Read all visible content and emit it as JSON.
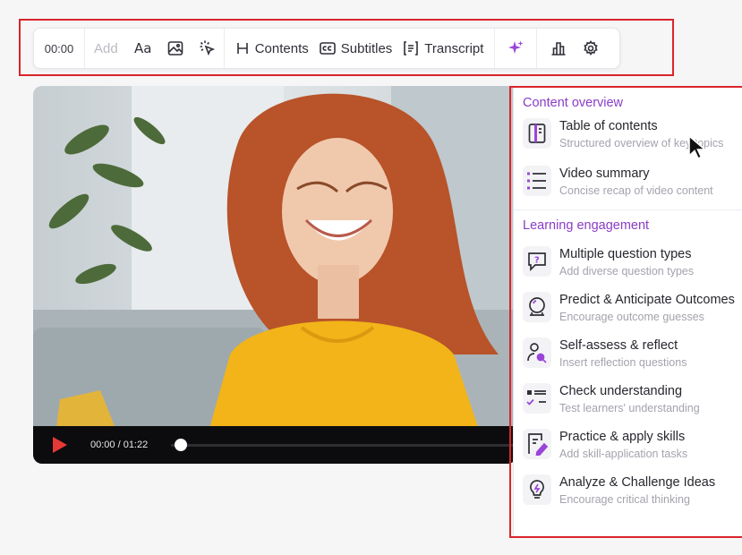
{
  "toolbar": {
    "time": "00:00",
    "add_label": "Add",
    "contents_label": "Contents",
    "subtitles_label": "Subtitles",
    "transcript_label": "Transcript",
    "icons": [
      "text-style-icon",
      "image-icon",
      "interactive-click-icon",
      "heading-icon",
      "subtitles-icon",
      "transcript-icon",
      "sparkle-icon",
      "chart-icon",
      "gear-icon"
    ]
  },
  "player": {
    "time": "00:00 / 01:22",
    "progress_percent": 0
  },
  "menu": {
    "section1_title": "Content overview",
    "section2_title": "Learning engagement",
    "items": [
      {
        "title": "Table of contents",
        "subtitle": "Structured overview of key topics",
        "icon": "book-icon"
      },
      {
        "title": "Video summary",
        "subtitle": "Concise recap of video content",
        "icon": "list-icon"
      },
      {
        "title": "Multiple question types",
        "subtitle": "Add diverse question types",
        "icon": "question-icon"
      },
      {
        "title": "Predict & Anticipate Outcomes",
        "subtitle": "Encourage outcome guesses",
        "icon": "crystal-ball-icon"
      },
      {
        "title": "Self-assess & reflect",
        "subtitle": "Insert reflection questions",
        "icon": "person-search-icon"
      },
      {
        "title": "Check understanding",
        "subtitle": "Test learners' understanding",
        "icon": "checklist-icon"
      },
      {
        "title": "Practice & apply skills",
        "subtitle": "Add skill-application tasks",
        "icon": "edit-document-icon"
      },
      {
        "title": "Analyze & Challenge Ideas",
        "subtitle": "Encourage critical thinking",
        "icon": "lightbulb-icon"
      }
    ]
  },
  "colors": {
    "accent": "#8a3cc7",
    "highlight": "#d9252b",
    "play": "#e53935"
  }
}
